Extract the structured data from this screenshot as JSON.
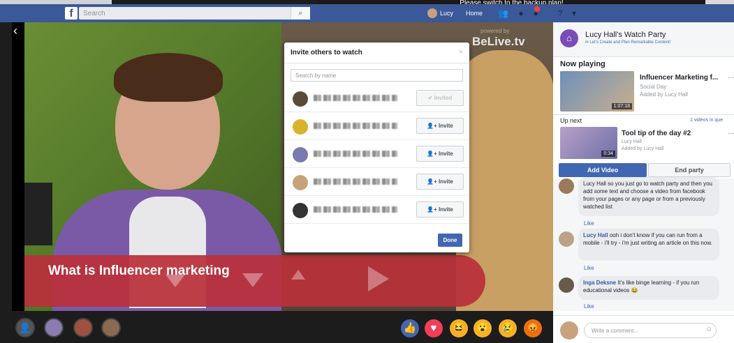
{
  "background": {
    "banner_text": "Please switch to the backup plan!"
  },
  "fb_bar": {
    "logo": "f",
    "search_placeholder": "Search",
    "search_icon": "search-icon",
    "user_name": "Lucy",
    "home_label": "Home"
  },
  "video": {
    "watermark_small": "powered by",
    "watermark": "BeLive.tv",
    "banner_text": "What is Influencer marketing"
  },
  "sidebar": {
    "title": "Lucy Hall's Watch Party",
    "subtitle": "in Let's Create and Plan Remarkable Content!",
    "now_playing_label": "Now playing",
    "now_playing": {
      "title": "Influencer Marketing f...",
      "source": "Social Day",
      "added_by": "Added by Lucy Hall",
      "duration": "1:07:18"
    },
    "up_next_label": "Up next",
    "up_next_count": "1 videos in que",
    "up_next": {
      "title": "Tool tip of the day #2",
      "source": "Lucy Hall",
      "added_by": "Added by Lucy Hall",
      "duration": "0:34"
    },
    "add_video_label": "Add Video",
    "end_party_label": "End party",
    "comments": [
      {
        "author": "",
        "text": "Lucy Hall so you just go to watch party and then you add some text and choose a video from facebook from your pages or any page or from a previously watched list",
        "like_label": "Like"
      },
      {
        "author": "Lucy Hall",
        "text": "ooh i don't know if you can run from a mobile - i'll try - i'm just writing an article on this now.",
        "like_label": "Like"
      },
      {
        "author": "Inga Deksne",
        "text": "It's like binge learning - if you run educational videos 😂",
        "like_label": "Like"
      }
    ],
    "comment_placeholder": "Write a comment..."
  },
  "modal": {
    "title": "Invite others to watch",
    "close_icon": "×",
    "search_placeholder": "Search by name",
    "rows": [
      {
        "status_label": "✔ Invited",
        "invited": true,
        "avatar_color": "#5a4a3a"
      },
      {
        "status_label": "Invite",
        "invited": false,
        "avatar_color": "#d8b22a"
      },
      {
        "status_label": "Invite",
        "invited": false,
        "avatar_color": "#7a7ab0"
      },
      {
        "status_label": "Invite",
        "invited": false,
        "avatar_color": "#c7a27a"
      },
      {
        "status_label": "Invite",
        "invited": false,
        "avatar_color": "#333333"
      }
    ],
    "done_label": "Done"
  },
  "reactions": [
    "like-icon",
    "love-icon",
    "haha-icon",
    "wow-icon",
    "sad-icon",
    "angry-icon"
  ]
}
